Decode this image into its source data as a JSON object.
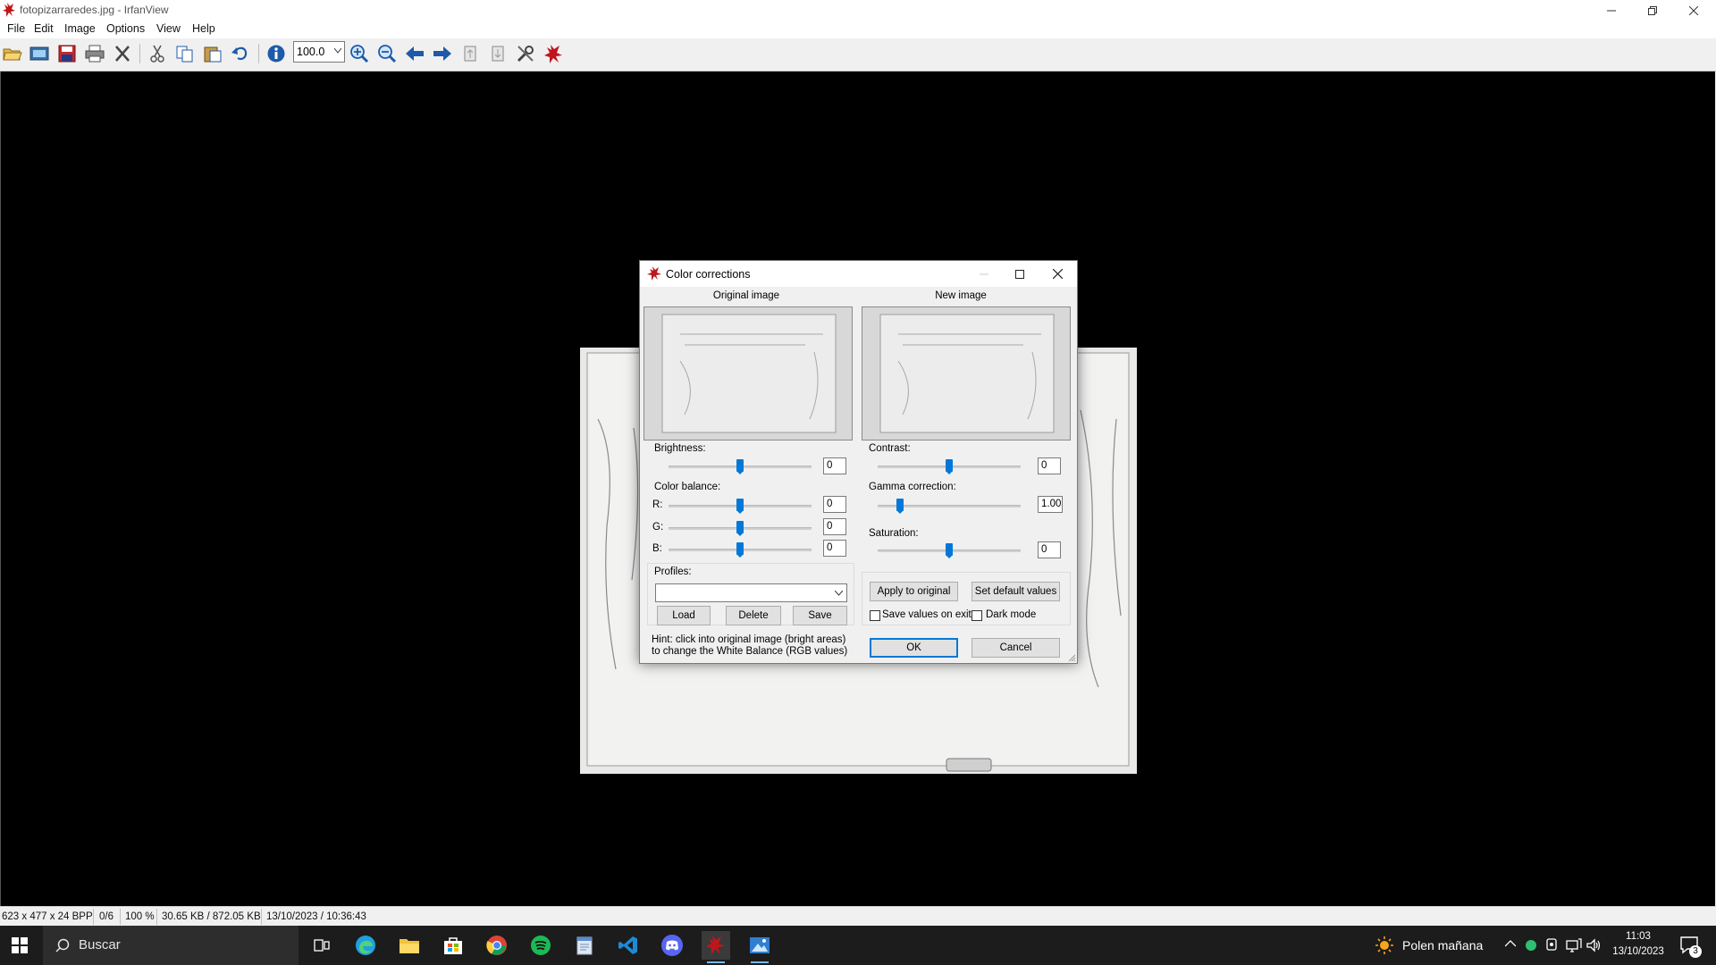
{
  "window": {
    "title": "fotopizarraredes.jpg - IrfanView",
    "minimize_icon": "minimize-icon",
    "restore_icon": "restore-icon",
    "close_icon": "close-icon"
  },
  "menu": [
    "File",
    "Edit",
    "Image",
    "Options",
    "View",
    "Help"
  ],
  "toolbar": {
    "zoom_value": "100.0",
    "buttons": [
      "open-icon",
      "slideshow-icon",
      "save-icon",
      "print-icon",
      "delete-icon",
      "cut-icon",
      "copy-icon",
      "paste-icon",
      "undo-icon",
      "info-icon",
      "zoom-in-icon",
      "zoom-out-icon",
      "previous-icon",
      "next-icon",
      "first-page-icon",
      "last-page-icon",
      "settings-icon",
      "irfanview-icon"
    ]
  },
  "dialog": {
    "title": "Color corrections",
    "original_label": "Original image",
    "new_label": "New image",
    "brightness_label": "Brightness:",
    "brightness_value": "0",
    "contrast_label": "Contrast:",
    "contrast_value": "0",
    "color_balance_label": "Color balance:",
    "r_label": "R:",
    "r_value": "0",
    "g_label": "G:",
    "g_value": "0",
    "b_label": "B:",
    "b_value": "0",
    "gamma_label": "Gamma correction:",
    "gamma_value": "1.00",
    "saturation_label": "Saturation:",
    "saturation_value": "0",
    "profiles_label": "Profiles:",
    "profile_selected": "",
    "load_button": "Load",
    "delete_button": "Delete",
    "save_button": "Save",
    "apply_button": "Apply to original",
    "default_button": "Set default values",
    "save_on_exit_label": "Save values on exit",
    "dark_mode_label": "Dark mode",
    "hint": "Hint: click into original image (bright areas) to change the White Balance (RGB values)",
    "ok_button": "OK",
    "cancel_button": "Cancel"
  },
  "statusbar": [
    "623 x 477 x 24 BPP",
    "0/6",
    "100 %",
    "30.65 KB / 872.05 KB",
    "13/10/2023 / 10:36:43"
  ],
  "taskbar": {
    "search_placeholder": "Buscar",
    "apps": [
      "task-view-icon",
      "edge-icon",
      "file-explorer-icon",
      "store-icon",
      "chrome-icon",
      "spotify-icon",
      "notepad-icon",
      "vscode-icon",
      "discord-icon",
      "irfanview-icon",
      "photos-icon"
    ],
    "weather_text": "Polen mañana",
    "time": "11:03",
    "date": "13/10/2023",
    "notification_count": "3"
  },
  "colors": {
    "accent": "#0078d7",
    "taskbar": "#1c1c1c",
    "viewer_background": "#000000"
  }
}
